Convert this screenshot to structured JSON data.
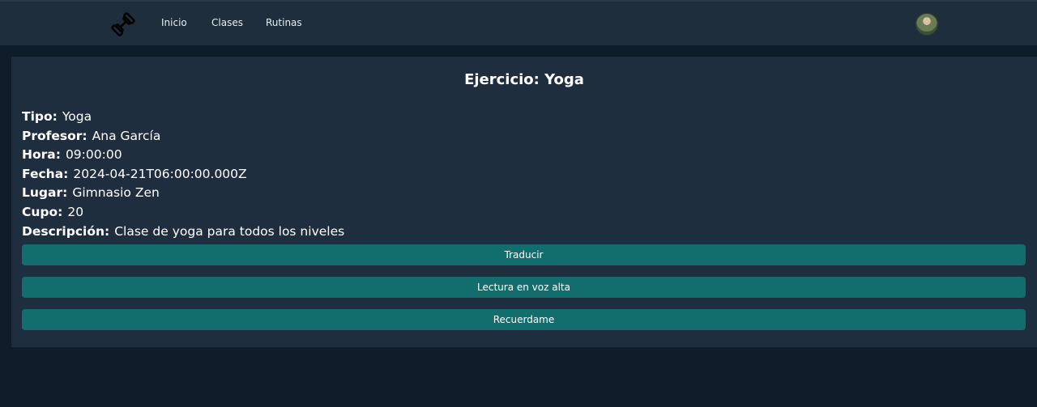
{
  "nav": {
    "logo_icon": "dumbbell-icon",
    "links": [
      "Inicio",
      "Clases",
      "Rutinas"
    ],
    "avatar": "user-avatar"
  },
  "card": {
    "title": "Ejercicio: Yoga",
    "fields": [
      {
        "label": "Tipo:",
        "value": "Yoga"
      },
      {
        "label": "Profesor:",
        "value": "Ana García"
      },
      {
        "label": "Hora:",
        "value": "09:00:00"
      },
      {
        "label": "Fecha:",
        "value": "2024-04-21T06:00:00.000Z"
      },
      {
        "label": "Lugar:",
        "value": "Gimnasio Zen"
      },
      {
        "label": "Cupo:",
        "value": "20"
      },
      {
        "label": "Descripción:",
        "value": "Clase de yoga para todos los niveles"
      }
    ],
    "buttons": [
      "Traducir",
      "Lectura en voz alta",
      "Recuerdame"
    ]
  },
  "colors": {
    "background": "#0f1c2a",
    "navbar": "#1e2e3d",
    "card": "#1f2e3e",
    "button": "#116e6c"
  }
}
